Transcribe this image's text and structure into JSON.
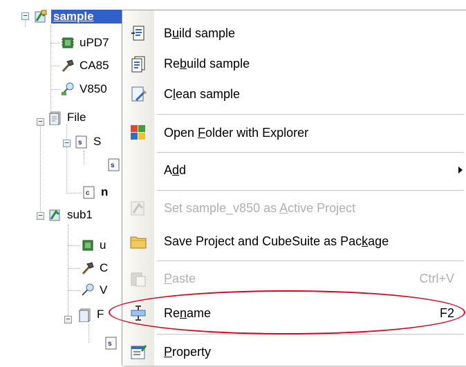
{
  "tree": {
    "nodes": [
      {
        "id": "project-sample",
        "label": "sample",
        "icon": "project-icon"
      },
      {
        "id": "microcontroller",
        "label": "uPD7",
        "icon": "chip-icon"
      },
      {
        "id": "build-tool",
        "label": "CA85",
        "icon": "hammer-icon"
      },
      {
        "id": "debug-tool",
        "label": "V850",
        "icon": "debugger-icon"
      },
      {
        "id": "file-folder",
        "label": "File",
        "icon": "folder-icon"
      },
      {
        "id": "source-folder",
        "label": "S",
        "icon": "source-icon"
      },
      {
        "id": "source-file",
        "label": "",
        "icon": "source-file-icon"
      },
      {
        "id": "header-file",
        "label": "n",
        "icon": "file-icon"
      },
      {
        "id": "project-sub1",
        "label": "sub1",
        "icon": "project-icon"
      },
      {
        "id": "sub1-microcontroller",
        "label": "u",
        "icon": "chip-icon"
      },
      {
        "id": "sub1-build-tool",
        "label": "C",
        "icon": "hammer-icon"
      },
      {
        "id": "sub1-debug-tool",
        "label": "V",
        "icon": "debugger-icon"
      },
      {
        "id": "sub1-file-folder",
        "label": "F",
        "icon": "folder-icon"
      },
      {
        "id": "sub1-source",
        "label": "",
        "icon": "source-file-icon"
      }
    ]
  },
  "menu": {
    "items": [
      {
        "pre": "B",
        "acc": "u",
        "post": "ild sample",
        "shortcut": "",
        "icon": "build-icon",
        "disabled": false
      },
      {
        "pre": "Re",
        "acc": "b",
        "post": "uild sample",
        "shortcut": "",
        "icon": "rebuild-icon",
        "disabled": false
      },
      {
        "pre": "C",
        "acc": "l",
        "post": "ean sample",
        "shortcut": "",
        "icon": "clean-icon",
        "disabled": false
      },
      {
        "pre": "Open ",
        "acc": "F",
        "post": "older with Explorer",
        "shortcut": "",
        "icon": "explorer-folder-icon",
        "disabled": false
      },
      {
        "pre": "A",
        "acc": "d",
        "post": "d",
        "shortcut": "",
        "icon": "",
        "disabled": false,
        "submenu": true
      },
      {
        "pre": "Set sample_v850 as ",
        "acc": "A",
        "post": "ctive Project",
        "shortcut": "",
        "icon": "active-project-icon",
        "disabled": true
      },
      {
        "pre": "Save Project and CubeSuite as Pac",
        "acc": "k",
        "post": "age",
        "shortcut": "",
        "icon": "package-folder-icon",
        "disabled": false
      },
      {
        "pre": "",
        "acc": "P",
        "post": "aste",
        "shortcut": "Ctrl+V",
        "icon": "paste-icon",
        "disabled": true
      },
      {
        "pre": "Re",
        "acc": "n",
        "post": "ame",
        "shortcut": "F2",
        "icon": "rename-icon",
        "disabled": false
      },
      {
        "pre": "",
        "acc": "P",
        "post": "roperty",
        "shortcut": "",
        "icon": "property-icon",
        "disabled": false
      }
    ]
  },
  "colors": {
    "selection": "#3160c9",
    "highlight_ellipse": "#e0001b",
    "disabled_text": "#b0b0b0"
  }
}
